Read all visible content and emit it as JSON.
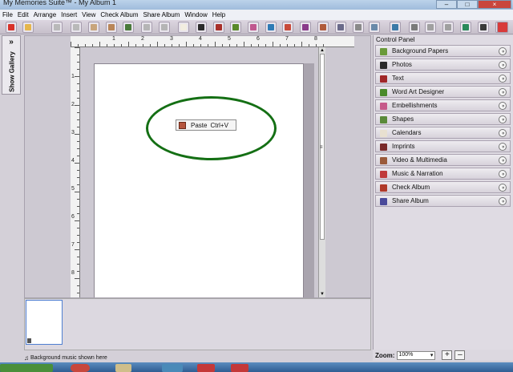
{
  "window": {
    "title": "My Memories Suite™ - My Album 1",
    "minimize": "–",
    "maximize": "□",
    "close": "×"
  },
  "menu": [
    "File",
    "Edit",
    "Arrange",
    "Insert",
    "View",
    "Check Album",
    "Share Album",
    "Window",
    "Help"
  ],
  "toolbar": {
    "buttons": [
      {
        "name": "new-album-icon",
        "color": "#d8322a"
      },
      {
        "name": "open-icon",
        "color": "#e5b64c"
      },
      {
        "name": "cut-icon",
        "color": "#b9b9b9"
      },
      {
        "name": "trash-icon",
        "color": "#b9b9b9"
      },
      {
        "name": "copy-icon",
        "color": "#c8a57c"
      },
      {
        "name": "paste-icon",
        "color": "#b98658"
      },
      {
        "name": "image-edit-icon",
        "color": "#4a7a3a"
      },
      {
        "name": "undo-icon",
        "color": "#b5b5b5"
      },
      {
        "name": "redo-icon",
        "color": "#b5b5b5"
      },
      {
        "name": "page-icon",
        "color": "#f2ede0"
      },
      {
        "name": "photo-icon",
        "color": "#2b2b2b"
      },
      {
        "name": "text-icon",
        "color": "#a82f2a"
      },
      {
        "name": "word-art-icon",
        "color": "#5a8a2a"
      },
      {
        "name": "embellishment-icon",
        "color": "#c0578f"
      },
      {
        "name": "shape-icon",
        "color": "#2f7bb5"
      },
      {
        "name": "calendar-icon",
        "color": "#c84a3a"
      },
      {
        "name": "imprint-icon",
        "color": "#8a3a8a"
      },
      {
        "name": "video-icon",
        "color": "#b05a3a"
      },
      {
        "name": "music-icon",
        "color": "#6a6a8a"
      },
      {
        "name": "check-icon",
        "color": "#8a8a8a"
      },
      {
        "name": "narration-icon",
        "color": "#6a8aaa"
      },
      {
        "name": "home-icon",
        "color": "#3a7aa8"
      },
      {
        "name": "layers-icon",
        "color": "#7a7a7a"
      },
      {
        "name": "send-back-icon",
        "color": "#a0a0a0"
      },
      {
        "name": "bring-front-icon",
        "color": "#a0a0a0"
      },
      {
        "name": "grid-icon",
        "color": "#2a8a5a"
      },
      {
        "name": "filmstrip-icon",
        "color": "#3a3a3a"
      },
      {
        "name": "cart-icon",
        "color": "#5a5a5a"
      },
      {
        "name": "help-icon",
        "color": "#3a6ab0"
      },
      {
        "name": "mymemories-icon",
        "color": "#d83a3a"
      }
    ]
  },
  "gallery_tab": {
    "arrow": "»",
    "label": "Show Gallery"
  },
  "ruler": {
    "horizontal": [
      "1",
      "2",
      "3",
      "4",
      "5",
      "6",
      "7",
      "8"
    ],
    "vertical": [
      "1",
      "2",
      "3",
      "4",
      "5",
      "6",
      "7",
      "8"
    ]
  },
  "scrollbar": {
    "up": "▲",
    "down": "▼",
    "grip": "≡"
  },
  "context_menu": {
    "label": "Paste",
    "shortcut": "Ctrl+V"
  },
  "control_panel": {
    "title": "Control Panel",
    "chevron": "»",
    "items": [
      {
        "label": "Background Papers",
        "icon": "background-papers-icon",
        "color": "#6a9a3a"
      },
      {
        "label": "Photos",
        "icon": "photos-icon",
        "color": "#2a2a2a"
      },
      {
        "label": "Text",
        "icon": "text-icon",
        "color": "#a02828"
      },
      {
        "label": "Word Art Designer",
        "icon": "word-art-icon",
        "color": "#4a8a2a"
      },
      {
        "label": "Embellishments",
        "icon": "embellishments-icon",
        "color": "#c65a8a"
      },
      {
        "label": "Shapes",
        "icon": "shapes-icon",
        "color": "#5a8a3a"
      },
      {
        "label": "Calendars",
        "icon": "calendars-icon",
        "color": "#e8e0d0"
      },
      {
        "label": "Imprints",
        "icon": "imprints-icon",
        "color": "#7a2a2a"
      },
      {
        "label": "Video & Multimedia",
        "icon": "video-icon",
        "color": "#9a5a3a"
      },
      {
        "label": "Music & Narration",
        "icon": "music-narration-icon",
        "color": "#c03a3a"
      },
      {
        "label": "Check Album",
        "icon": "check-album-icon",
        "color": "#b03a2a"
      },
      {
        "label": "Share Album",
        "icon": "share-album-icon",
        "color": "#4a4a9a"
      }
    ]
  },
  "zoom": {
    "label": "Zoom:",
    "value": "100%",
    "dropdown": "▾",
    "plus": "+",
    "minus": "–"
  },
  "pages_strip": {
    "background_music_text": "Background music shown here",
    "music_glyph": "♫"
  },
  "colors": {
    "accent": "#146f14",
    "thumbnail_border": "#4f7fd1"
  }
}
